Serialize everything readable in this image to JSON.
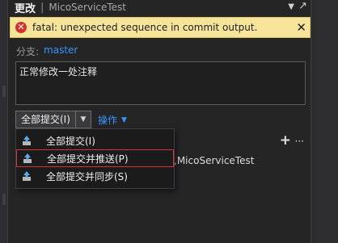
{
  "header": {
    "title": "更改",
    "separator": "|",
    "repo": "MicoServiceTest"
  },
  "error": {
    "message": "fatal: unexpected sequence in commit output.",
    "icon": "error-icon",
    "close_symbol": "✕",
    "color": "#f6e49a"
  },
  "branch": {
    "label": "分支:",
    "value": "master"
  },
  "commit_message": "正常修改一处注释",
  "commit_button": {
    "label": "全部提交(I)"
  },
  "actions": {
    "label": "操作"
  },
  "dropdown_menu": {
    "items": [
      {
        "label": "全部提交(I)",
        "icon": "commit-icon"
      },
      {
        "label": "全部提交并推送(P)",
        "icon": "commit-push-icon"
      },
      {
        "label": "全部提交并同步(S)",
        "icon": "commit-sync-icon"
      }
    ],
    "highlighted_color": "#d1343a"
  },
  "background_row": {
    "repo_text": "MicoServiceTest"
  },
  "accent_color": "#3794ff"
}
